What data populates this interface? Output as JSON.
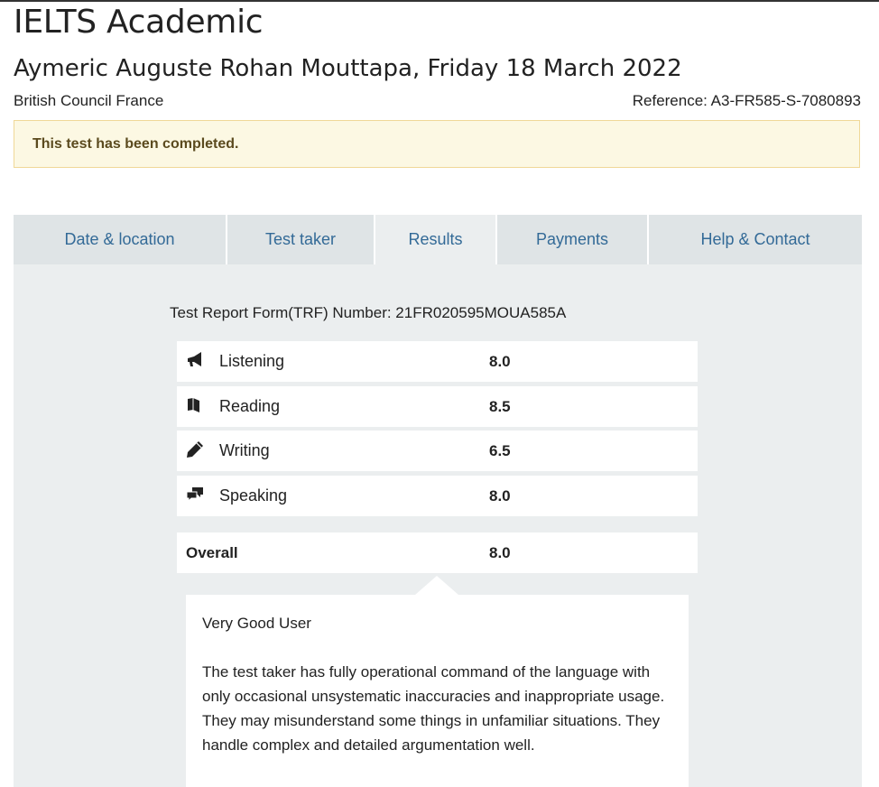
{
  "header": {
    "app_title": "IELTS Academic",
    "candidate_line": "Aymeric Auguste Rohan Mouttapa, Friday 18 March 2022",
    "venue": "British Council France",
    "reference": "Reference: A3-FR585-S-7080893"
  },
  "alert": {
    "message": "This test has been completed."
  },
  "tabs": [
    {
      "label": "Date & location",
      "active": false
    },
    {
      "label": "Test taker",
      "active": false
    },
    {
      "label": "Results",
      "active": true
    },
    {
      "label": "Payments",
      "active": false
    },
    {
      "label": "Help & Contact",
      "active": false
    }
  ],
  "results": {
    "trf_line": "Test Report Form(TRF) Number: 21FR020595MOUA585A",
    "scores": [
      {
        "icon": "megaphone-icon",
        "label": "Listening",
        "score": "8.0"
      },
      {
        "icon": "book-icon",
        "label": "Reading",
        "score": "8.5"
      },
      {
        "icon": "pencil-icon",
        "label": "Writing",
        "score": "6.5"
      },
      {
        "icon": "speech-bubbles-icon",
        "label": "Speaking",
        "score": "8.0"
      }
    ],
    "overall": {
      "label": "Overall",
      "score": "8.0"
    },
    "band_title": "Very Good User",
    "band_description": "The test taker has fully operational command of the language with only occasional unsystematic inaccuracies and inappropriate usage. They may misunderstand some things in unfamiliar situations. They handle complex and detailed argumentation well."
  },
  "colors": {
    "tab_text": "#336a97",
    "tab_bg": "#dfe4e6",
    "panel_bg": "#ebeeef",
    "alert_bg": "#fcf8e3",
    "alert_border": "#f0d898",
    "alert_text": "#5b4a1e"
  }
}
